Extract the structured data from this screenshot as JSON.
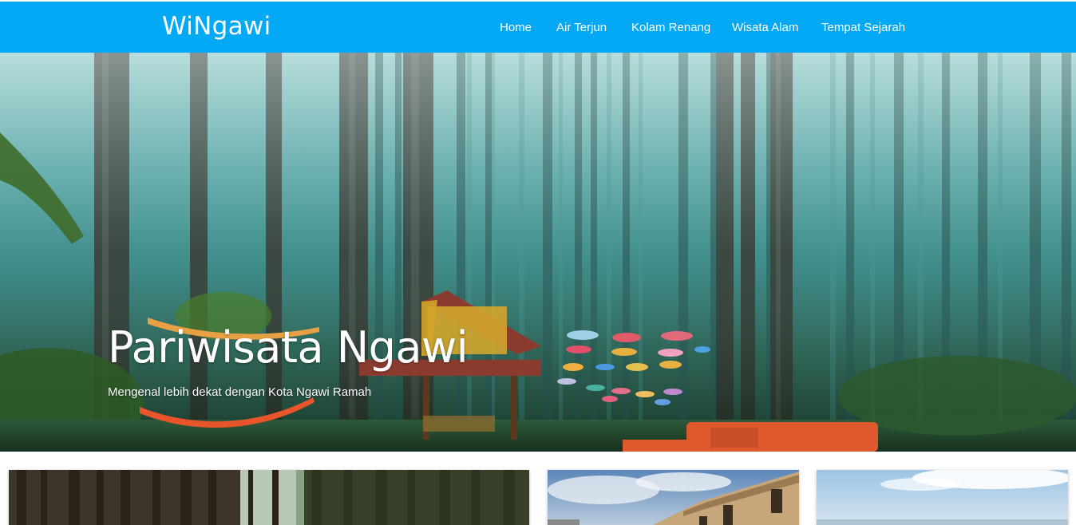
{
  "navbar": {
    "brand": "WiNgawi",
    "links": [
      {
        "label": "Home"
      },
      {
        "label": "Air Terjun"
      },
      {
        "label": "Kolam Renang"
      },
      {
        "label": "Wisata Alam"
      },
      {
        "label": "Tempat Sejarah"
      }
    ],
    "bg_color": "#03a9f4"
  },
  "hero": {
    "title": "Pariwisata Ngawi",
    "subtitle": "Mengenal lebih dekat dengan Kota Ngawi Ramah",
    "image": "misty pine forest with hammocks, wooden hut and colorful umbrellas"
  },
  "cards": [
    {
      "image": "pine forest path"
    },
    {
      "image": "historic fort building under cloudy sky"
    },
    {
      "image": "sky with clouds"
    }
  ]
}
